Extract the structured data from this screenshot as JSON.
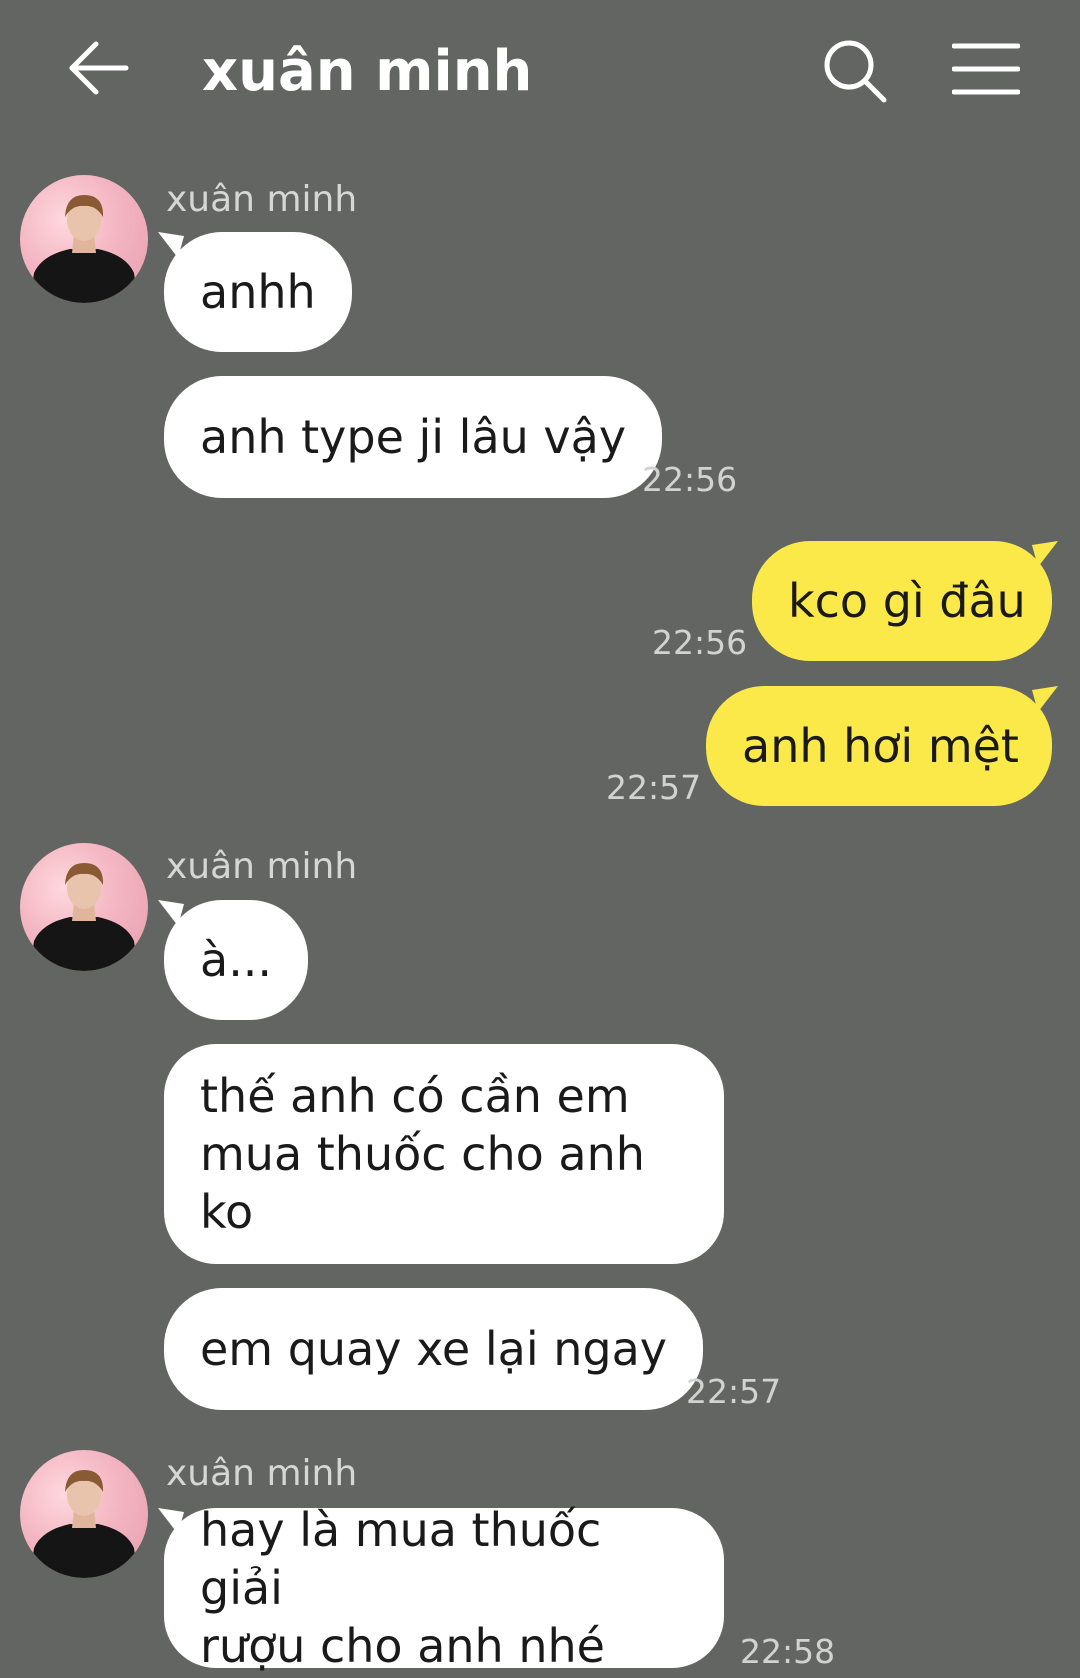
{
  "header": {
    "title": "xuân minh",
    "back_icon": "arrow-left-icon",
    "search_icon": "search-icon",
    "menu_icon": "hamburger-menu-icon"
  },
  "colors": {
    "background": "#636563",
    "incoming_bubble": "#ffffff",
    "outgoing_bubble": "#fbe94a",
    "text": "#1a1a1a",
    "meta_text": "#d2d2d2"
  },
  "groups": [
    {
      "sender": "xuân minh",
      "messages": [
        {
          "text": "anhh"
        },
        {
          "text": "anh type ji lâu vậy",
          "time": "22:56"
        }
      ]
    },
    {
      "sender": "me",
      "messages": [
        {
          "text": "kco gì đâu",
          "time": "22:56"
        },
        {
          "text": "anh hơi mệt",
          "time": "22:57"
        }
      ]
    },
    {
      "sender": "xuân minh",
      "messages": [
        {
          "text": "à..."
        },
        {
          "lines": [
            "thế anh có cần em",
            "mua thuốc cho anh",
            "ko"
          ]
        },
        {
          "text": "em quay xe lại ngay",
          "time": "22:57"
        }
      ]
    },
    {
      "sender": "xuân minh",
      "messages": [
        {
          "lines": [
            "hay là mua thuốc giải",
            "rượu cho anh nhé"
          ],
          "time": "22:58"
        }
      ]
    }
  ]
}
